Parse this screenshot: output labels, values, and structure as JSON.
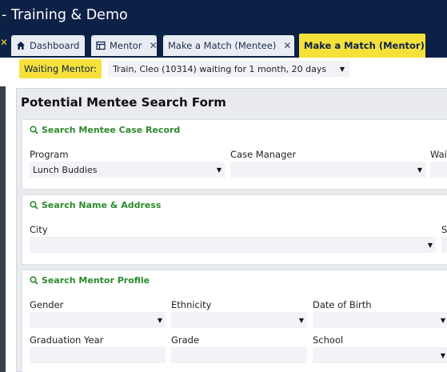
{
  "app": {
    "title": "- Training & Demo"
  },
  "tabs": [
    {
      "label": "Dashboard",
      "icon": "home-icon",
      "closable": false
    },
    {
      "label": "Mentor",
      "icon": "table-icon",
      "closable": true
    },
    {
      "label": "Make a Match (Mentee)",
      "icon": "",
      "closable": true
    },
    {
      "label": "Make a Match (Mentor)",
      "icon": "",
      "closable": true,
      "active": true
    }
  ],
  "tab_close_glyph": "✕",
  "waiting": {
    "label": "Waiting Mentor:",
    "value": "Train, Cleo (10314) waiting for 1 month, 20 days"
  },
  "form": {
    "title": "Potential Mentee Search Form",
    "sections": {
      "case_record": {
        "title": "Search Mentee Case Record",
        "program_label": "Program",
        "program_value": "Lunch Buddies",
        "case_manager_label": "Case Manager",
        "case_manager_value": "",
        "wait_label": "Wai"
      },
      "name_address": {
        "title": "Search Name & Address",
        "city_label": "City",
        "city_value": "",
        "st_label": "S"
      },
      "mentor_profile": {
        "title": "Search Mentor Profile",
        "gender_label": "Gender",
        "ethnicity_label": "Ethnicity",
        "dob_label": "Date of Birth",
        "grad_year_label": "Graduation Year",
        "grade_label": "Grade",
        "school_label": "School"
      }
    }
  },
  "colors": {
    "navy": "#0d2147",
    "yellow": "#f5e13a",
    "green": "#2d8a2d"
  }
}
